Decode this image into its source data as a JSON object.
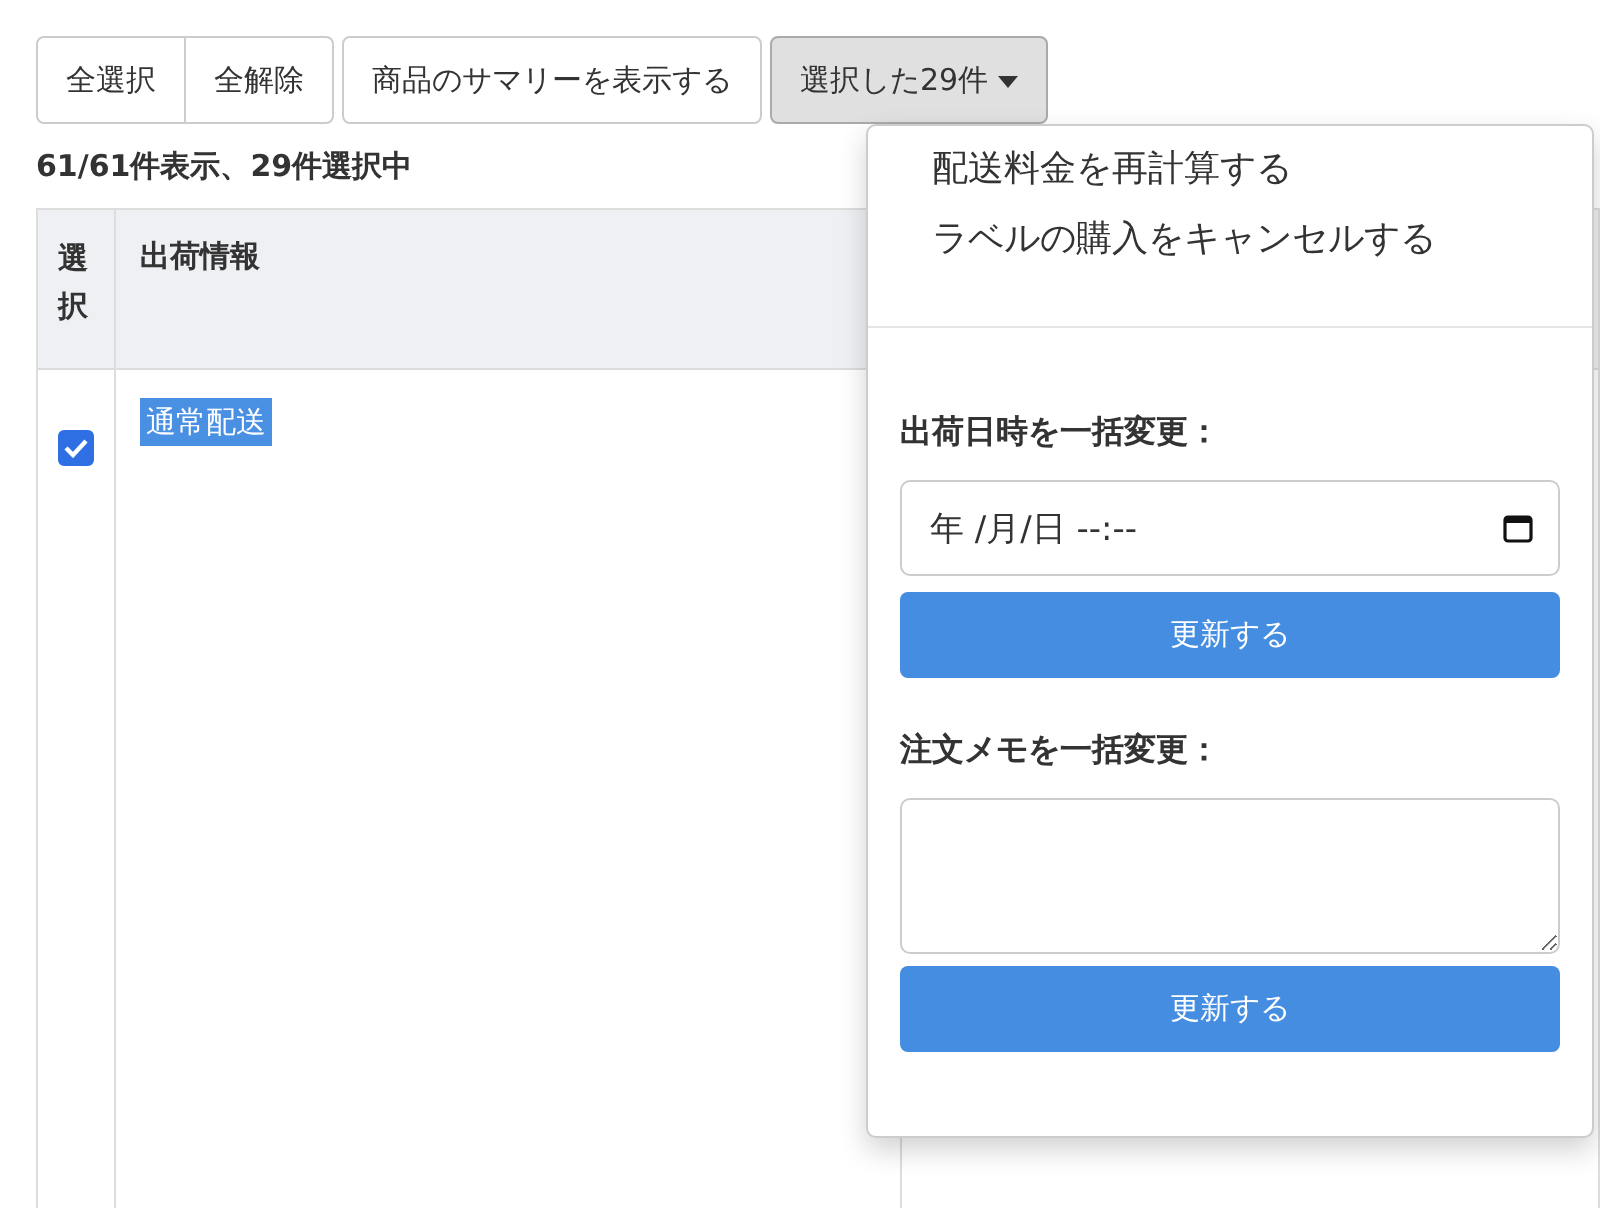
{
  "toolbar": {
    "button_groups": [
      [
        "全選択",
        "全解除"
      ],
      [
        "商品のサマリーを表示する"
      ]
    ],
    "bulk_dropdown": {
      "label": "選択した29件",
      "expanded": true,
      "menu_items": [
        "配送料金を再計算する",
        "ラベルの購入をキャンセルする"
      ],
      "sections": [
        {
          "kind": "datetime",
          "label": "出荷日時を一括変更：",
          "value": "年 /月/日 --:--",
          "button": "更新する"
        },
        {
          "kind": "textarea",
          "label": "注文メモを一括変更：",
          "button": "更新する"
        }
      ]
    }
  },
  "summary": "61/61件表示、29件選択中",
  "table": {
    "columns": [
      "選択",
      "出荷情報"
    ],
    "rows": [
      {
        "checked": true,
        "tag": "通常配送"
      }
    ]
  }
}
